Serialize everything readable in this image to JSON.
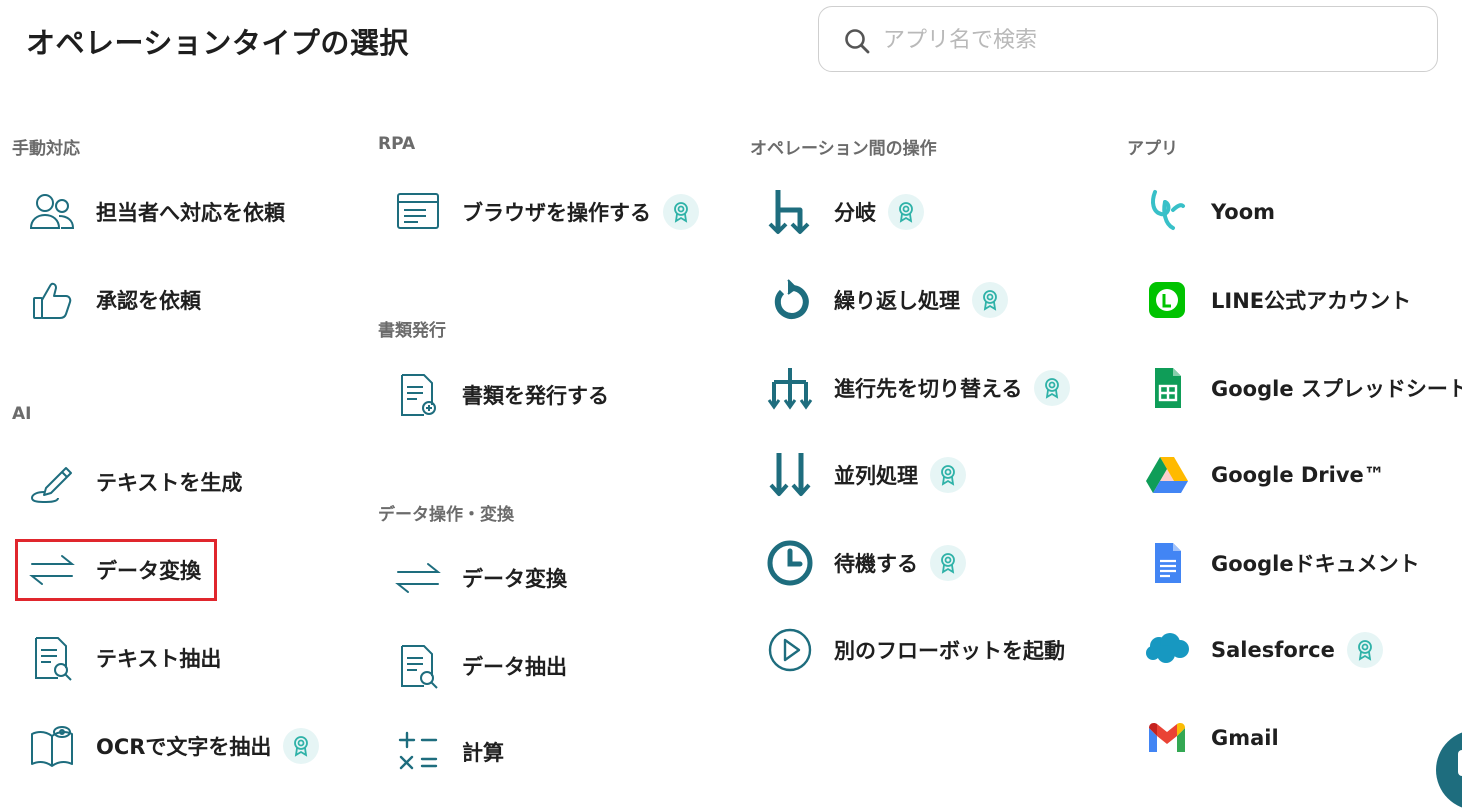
{
  "header": {
    "title": "オペレーションタイプの選択"
  },
  "search": {
    "placeholder": "アプリ名で検索",
    "value": ""
  },
  "colors": {
    "accent": "#1e6d7e",
    "highlight": "#e0262d",
    "badge_bg": "#e6f5f5"
  },
  "sections": {
    "manual": {
      "label": "手動対応",
      "items": [
        {
          "label": "担当者へ対応を依頼",
          "icon": "people-icon"
        },
        {
          "label": "承認を依頼",
          "icon": "thumbs-up-icon"
        }
      ]
    },
    "ai": {
      "label": "AI",
      "items": [
        {
          "label": "テキストを生成",
          "icon": "pencil-icon"
        },
        {
          "label": "データ変換",
          "icon": "transform-arrows-icon",
          "highlighted": true
        },
        {
          "label": "テキスト抽出",
          "icon": "document-search-icon"
        },
        {
          "label": "OCRで文字を抽出",
          "icon": "book-eye-icon",
          "premium": true
        }
      ]
    },
    "rpa": {
      "label": "RPA",
      "items": [
        {
          "label": "ブラウザを操作する",
          "icon": "browser-window-icon",
          "premium": true
        }
      ]
    },
    "docs": {
      "label": "書類発行",
      "items": [
        {
          "label": "書類を発行する",
          "icon": "document-add-icon"
        }
      ]
    },
    "data": {
      "label": "データ操作・変換",
      "items": [
        {
          "label": "データ変換",
          "icon": "transform-arrows-icon"
        },
        {
          "label": "データ抽出",
          "icon": "document-search-icon"
        },
        {
          "label": "計算",
          "icon": "calculator-symbols-icon"
        }
      ]
    },
    "flow": {
      "label": "オペレーション間の操作",
      "items": [
        {
          "label": "分岐",
          "icon": "branch-icon",
          "premium": true
        },
        {
          "label": "繰り返し処理",
          "icon": "loop-icon",
          "premium": true
        },
        {
          "label": "進行先を切り替える",
          "icon": "switch-path-icon",
          "premium": true
        },
        {
          "label": "並列処理",
          "icon": "parallel-arrows-icon",
          "premium": true
        },
        {
          "label": "待機する",
          "icon": "clock-icon",
          "premium": true
        },
        {
          "label": "別のフローボットを起動",
          "icon": "play-circle-icon"
        }
      ]
    },
    "apps": {
      "label": "アプリ",
      "items": [
        {
          "label": "Yoom",
          "icon": "yoom-logo-icon"
        },
        {
          "label": "LINE公式アカウント",
          "icon": "line-logo-icon"
        },
        {
          "label": "Google スプレッドシート",
          "icon": "google-sheets-icon"
        },
        {
          "label": "Google Drive™",
          "icon": "google-drive-icon"
        },
        {
          "label": "Googleドキュメント",
          "icon": "google-docs-icon"
        },
        {
          "label": "Salesforce",
          "icon": "salesforce-icon",
          "premium": true
        },
        {
          "label": "Gmail",
          "icon": "gmail-icon"
        }
      ]
    }
  }
}
